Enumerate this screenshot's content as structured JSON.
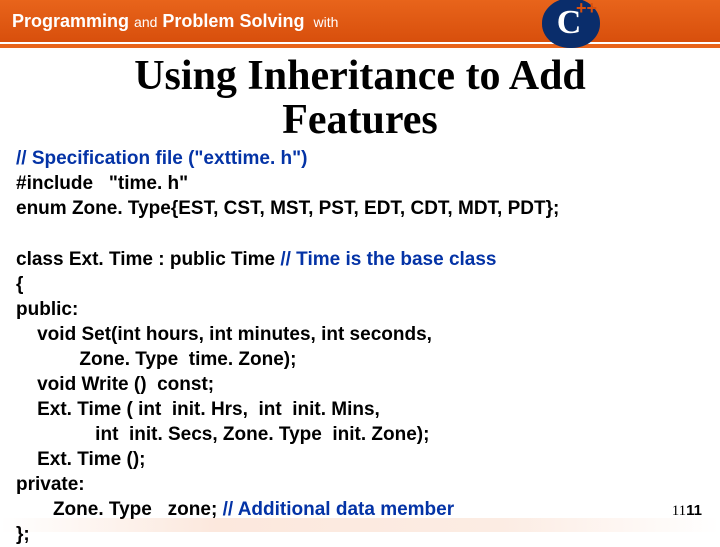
{
  "header": {
    "programming": "Programming",
    "and": "and",
    "problem_solving": "Problem Solving",
    "with": "with",
    "logo_c": "C",
    "logo_pp": "++"
  },
  "title_line1": "Using Inheritance to Add",
  "title_line2": "Features",
  "code": {
    "l1": "// Specification file (\"exttime. h\")",
    "l2": "#include   \"time. h\"",
    "l3": "enum Zone. Type{EST, CST, MST, PST, EDT, CDT, MDT, PDT};",
    "l4a": "class Ext. Time : public Time ",
    "l4b": "// Time is the base class",
    "l5": "{",
    "l6": "public:",
    "l7": "    void Set(int hours, int minutes, int seconds,",
    "l8": "            Zone. Type  time. Zone);",
    "l9": "    void Write ()  const;",
    "l10": "    Ext. Time ( int  init. Hrs,  int  init. Mins,",
    "l11": "               int  init. Secs, Zone. Type  init. Zone);",
    "l12": "    Ext. Time ();",
    "l13": "private:",
    "l14a": "       Zone. Type   zone; ",
    "l14b": "// Additional data member",
    "l15": "};"
  },
  "page": {
    "n1": "11",
    "n2": "11"
  }
}
